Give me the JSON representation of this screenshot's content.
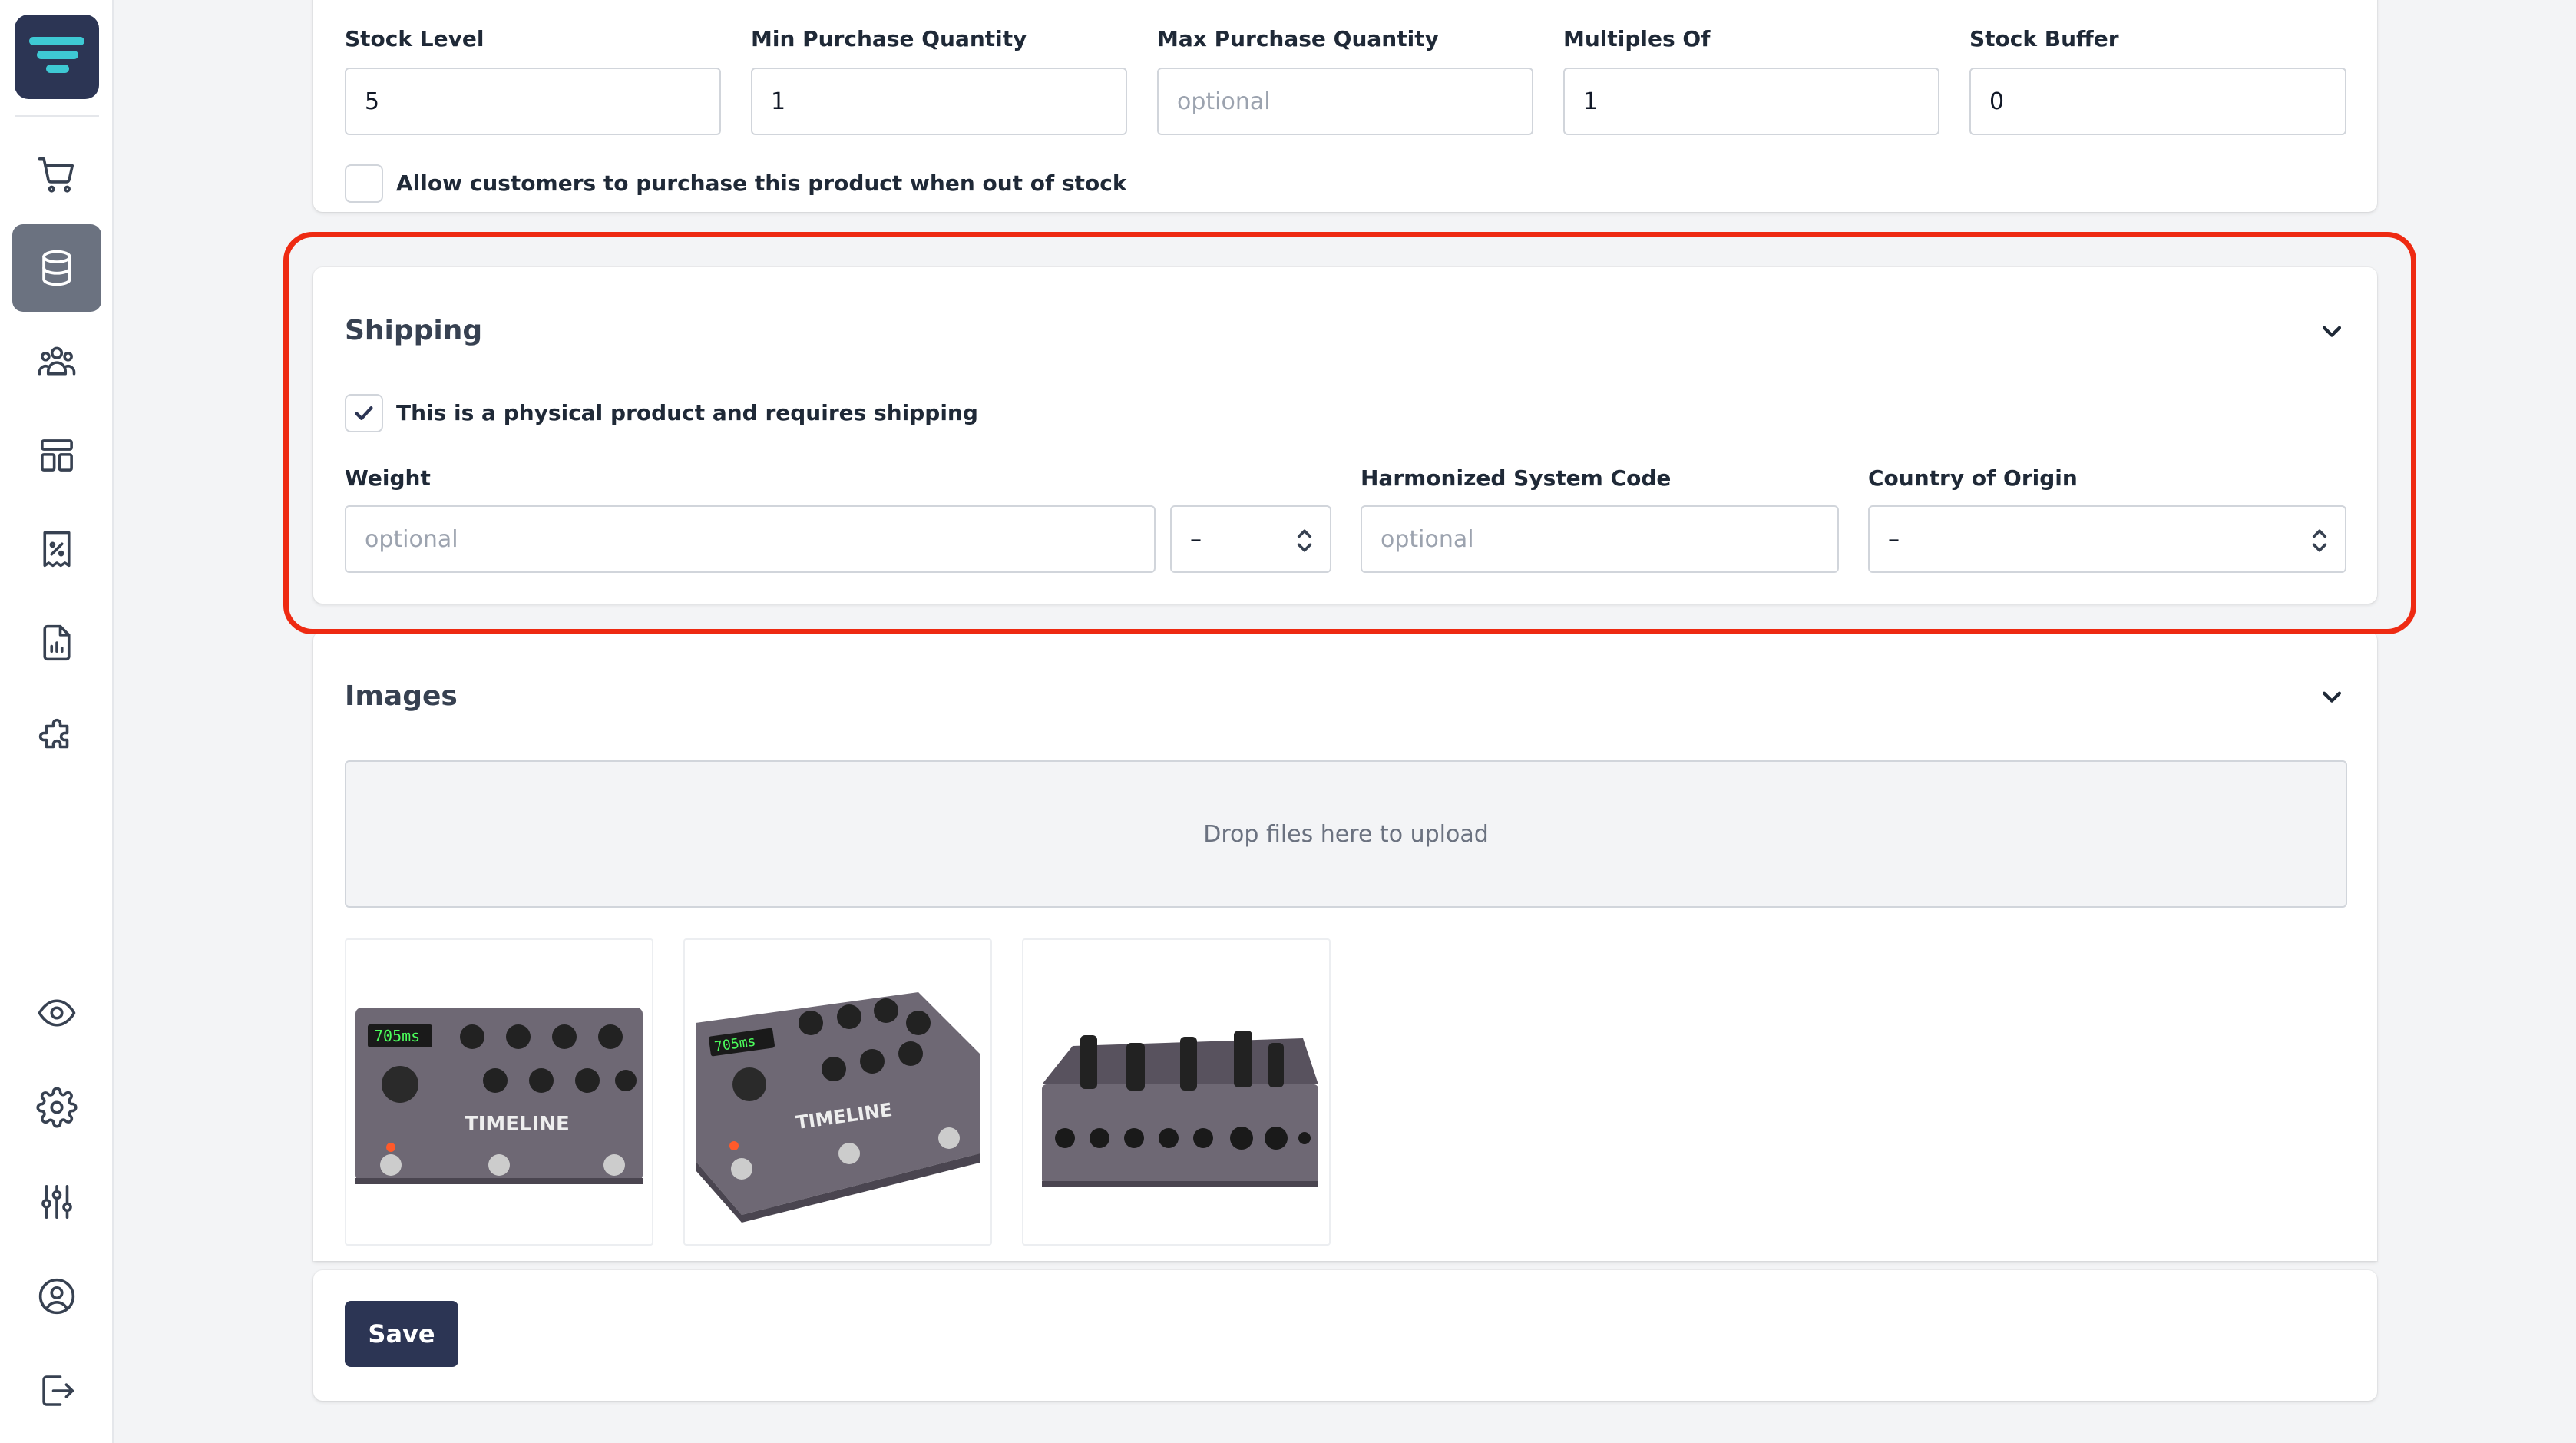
{
  "colors": {
    "brand": "#2c3554",
    "accent_logo": "#3ec9d4",
    "highlight": "#ee2a12",
    "sidebar_active": "#6b7280"
  },
  "sidebar": {
    "items": [
      {
        "icon": "cart-icon",
        "active": false
      },
      {
        "icon": "database-icon",
        "active": true
      },
      {
        "icon": "users-icon",
        "active": false
      },
      {
        "icon": "layout-icon",
        "active": false
      },
      {
        "icon": "discount-receipt-icon",
        "active": false
      },
      {
        "icon": "report-icon",
        "active": false
      },
      {
        "icon": "puzzle-icon",
        "active": false
      },
      {
        "icon": "eye-icon",
        "active": false
      },
      {
        "icon": "gear-icon",
        "active": false
      },
      {
        "icon": "sliders-icon",
        "active": false
      },
      {
        "icon": "user-circle-icon",
        "active": false
      },
      {
        "icon": "logout-icon",
        "active": false
      }
    ]
  },
  "inventory": {
    "stock_level": {
      "label": "Stock Level",
      "value": "5"
    },
    "min_qty": {
      "label": "Min Purchase Quantity",
      "value": "1"
    },
    "max_qty": {
      "label": "Max Purchase Quantity",
      "placeholder": "optional"
    },
    "multiples": {
      "label": "Multiples Of",
      "value": "1"
    },
    "stock_buffer": {
      "label": "Stock Buffer",
      "value": "0"
    },
    "backorder_label": "Allow customers to purchase this product when out of stock",
    "backorder_checked": false
  },
  "shipping": {
    "title": "Shipping",
    "physical_label": "This is a physical product and requires shipping",
    "physical_checked": true,
    "weight": {
      "label": "Weight",
      "placeholder": "optional"
    },
    "weight_unit": {
      "value": "–"
    },
    "hs_code": {
      "label": "Harmonized System Code",
      "placeholder": "optional"
    },
    "country": {
      "label": "Country of Origin",
      "value": "–"
    }
  },
  "images": {
    "title": "Images",
    "dropzone_text": "Drop files here to upload",
    "thumbnails": [
      "pedal-front-view",
      "pedal-angled-view",
      "pedal-rear-view"
    ]
  },
  "actions": {
    "save_label": "Save"
  }
}
